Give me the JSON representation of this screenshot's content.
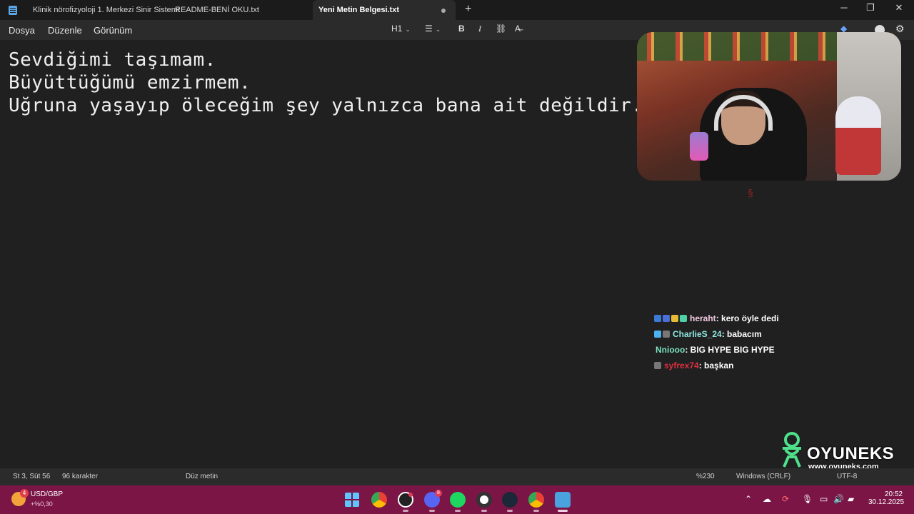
{
  "tabs": [
    {
      "title": "Klinik nörofizyoloji 1. Merkezi Sinir Sistemi"
    },
    {
      "title": "README-BENİ OKU.txt"
    },
    {
      "title": "Yeni Metin Belgesi.txt"
    }
  ],
  "window": {
    "minimize": "─",
    "maximize": "❐",
    "close": "✕",
    "new_tab": "+"
  },
  "menu": {
    "file": "Dosya",
    "edit": "Düzenle",
    "view": "Görünüm"
  },
  "toolbar": {
    "heading": "H1",
    "list_icon": "list-icon",
    "bold": "B",
    "italic": "I",
    "link_icon": "link-icon",
    "clear_format_icon": "clear-format-icon",
    "settings_icon": "gear-icon"
  },
  "document": {
    "lines": [
      "Sevdiğimi taşımam.",
      "Büyüttüğümü emzirmem.",
      "Uğruna yaşayıp öleceğim şey yalnızca bana ait değildir."
    ]
  },
  "chat": {
    "messages": [
      {
        "user": "heraht",
        "text": ": kero öyle dedi",
        "color": "#f0c8e0",
        "badges": [
          "#3b7bd6",
          "#4a6fd8",
          "#e8b838",
          "#4fd1a6"
        ]
      },
      {
        "user": "CharlieS_24",
        "text": ": babacım",
        "color": "#8fe8e0",
        "badges": [
          "#4ab3f0",
          "#777777"
        ]
      },
      {
        "user": "Nniooo",
        "text": ": BIG HYPE BIG HYPE",
        "color": "#7be0c0",
        "badges": []
      },
      {
        "user": "syfrex74",
        "text": ": başkan",
        "color": "#e03040",
        "badges": [
          "#777777"
        ]
      }
    ]
  },
  "watermark": {
    "name": "OYUNEKS",
    "url": "www.oyuneks.com"
  },
  "status": {
    "position": "St 3, Süt 56",
    "chars": "96 karakter",
    "format": "Düz metin",
    "zoom": "%230",
    "line_ending": "Windows (CRLF)",
    "encoding": "UTF-8"
  },
  "taskbar": {
    "weather_badge": "4",
    "ticker": "USD/GBP",
    "ticker_change": "+%0,30",
    "discord_badge": "8",
    "time": "20:52",
    "date": "30.12.2025",
    "colors": {
      "taskbar": "#7a1546",
      "editor": "#202020"
    }
  }
}
